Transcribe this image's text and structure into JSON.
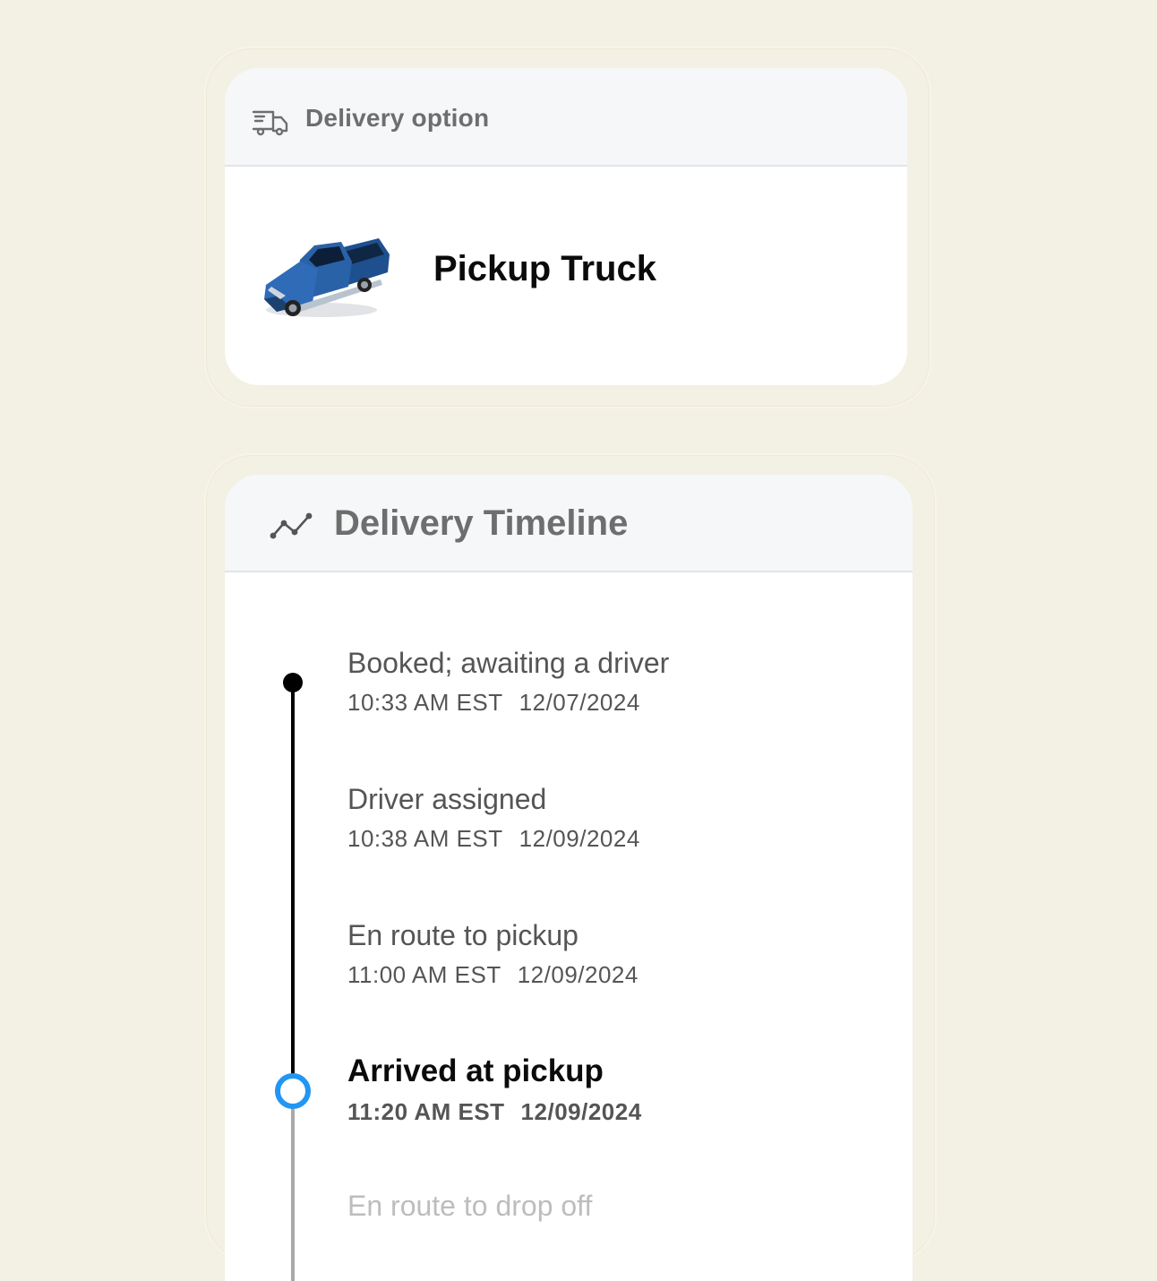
{
  "delivery_option": {
    "header_title": "Delivery option",
    "header_icon": "truck-icon",
    "vehicle_name": "Pickup Truck",
    "vehicle_image": "pickup-truck-image"
  },
  "timeline": {
    "header_title": "Delivery Timeline",
    "header_icon": "timeline-chart-icon",
    "events": [
      {
        "title": "Booked; awaiting a driver",
        "time": "10:33 AM EST",
        "date": "12/07/2024",
        "status": "done"
      },
      {
        "title": "Driver assigned",
        "time": "10:38 AM EST",
        "date": "12/09/2024",
        "status": "done"
      },
      {
        "title": "En route to pickup",
        "time": "11:00 AM EST",
        "date": "12/09/2024",
        "status": "done"
      },
      {
        "title": "Arrived at pickup",
        "time": "11:20 AM EST",
        "date": "12/09/2024",
        "status": "current"
      },
      {
        "title": "En route to drop off",
        "time": "",
        "date": "",
        "status": "pending"
      }
    ]
  },
  "colors": {
    "page_background": "#f3f0e4",
    "card_header": "#f6f7f9",
    "current_step": "#2196f3",
    "completed_line": "#000000",
    "pending_line": "#a9a9a9"
  }
}
